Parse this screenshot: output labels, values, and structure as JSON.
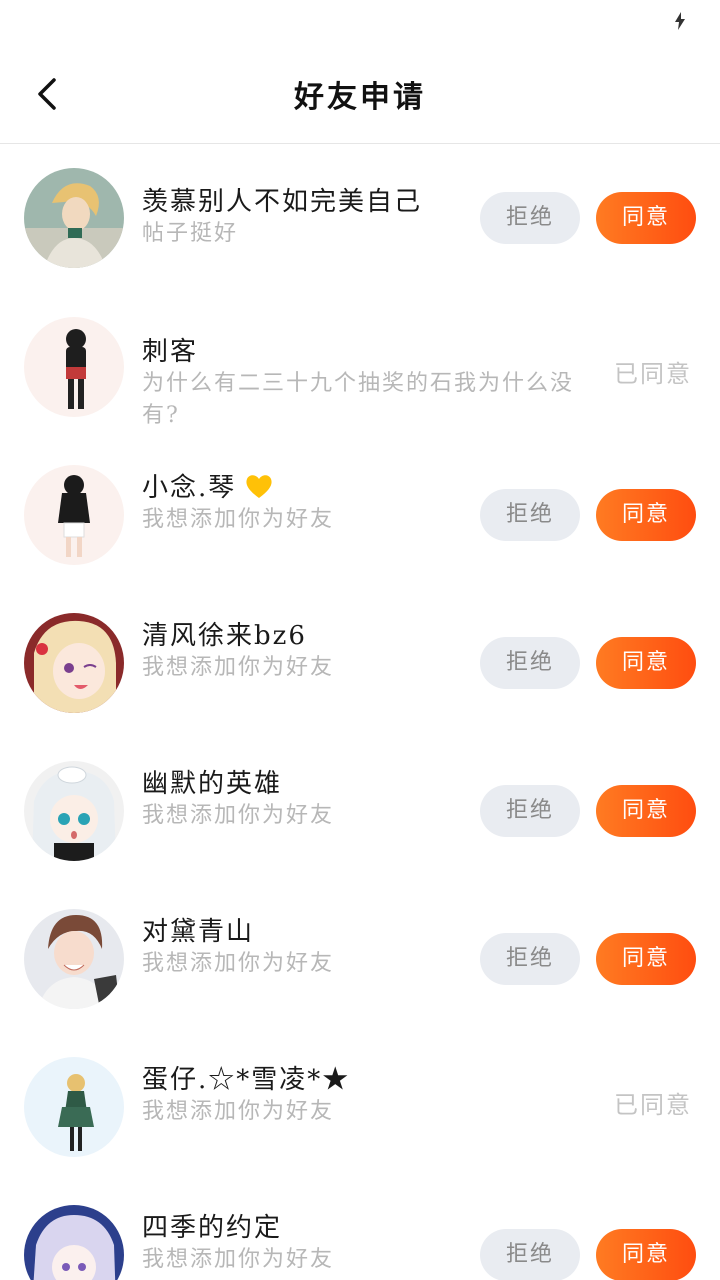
{
  "header": {
    "title": "好友申请"
  },
  "buttons": {
    "reject": "拒绝",
    "accept": "同意",
    "accepted": "已同意"
  },
  "requests": [
    {
      "name": "羡慕别人不如完美自己",
      "message": "帖子挺好"
    },
    {
      "name": "刺客",
      "message": "为什么有二三十九个抽奖的石我为什么没有?"
    },
    {
      "name": "小念.琴",
      "message": "我想添加你为好友"
    },
    {
      "name": "清风徐来bz6",
      "message": "我想添加你为好友"
    },
    {
      "name": "幽默的英雄",
      "message": "我想添加你为好友"
    },
    {
      "name": "对黛青山",
      "message": "我想添加你为好友"
    },
    {
      "name": "蛋仔.☆*雪凌*★",
      "message": "我想添加你为好友"
    },
    {
      "name": "四季的约定",
      "message": "我想添加你为好友"
    }
  ],
  "colors": {
    "accent": "#ff5a14",
    "reject_bg": "#e9ecf1",
    "muted": "#b7b7b7",
    "heart": "#ffc107"
  }
}
